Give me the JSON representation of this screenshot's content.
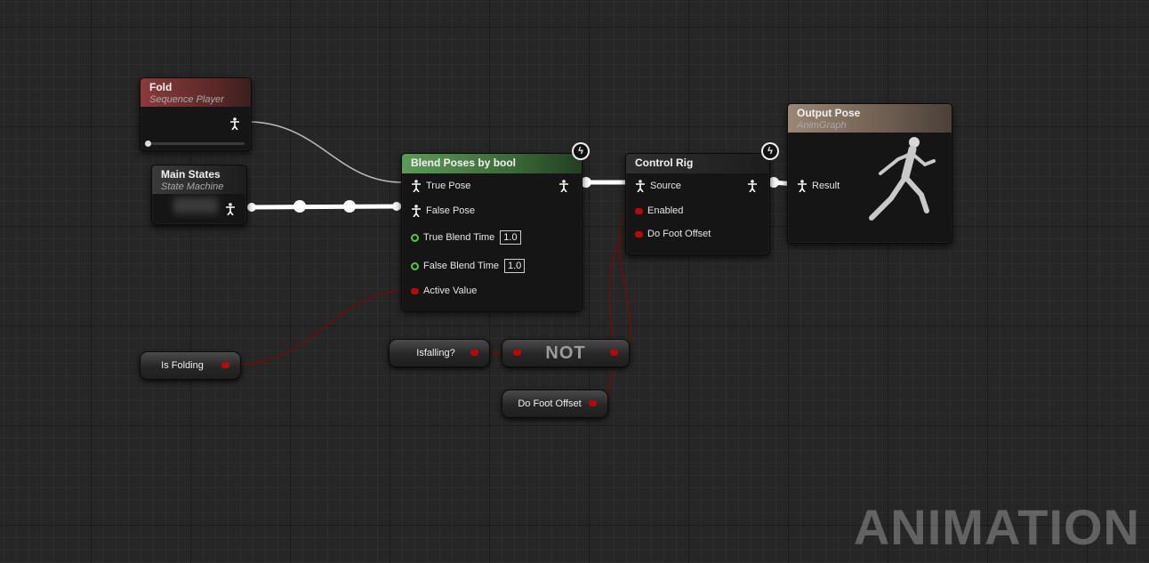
{
  "graph": {
    "watermark": "ANIMATION",
    "colors": {
      "pose_wire": "#ffffff",
      "bool_pin": "#b40a0a",
      "float_pin": "#56c94a",
      "blend_header": "#5a8a55",
      "fold_header": "#7a3535",
      "output_header": "#8f7d6a"
    }
  },
  "nodes": {
    "fold": {
      "title": "Fold",
      "subtitle": "Sequence Player"
    },
    "main_states": {
      "title": "Main States",
      "subtitle": "State Machine"
    },
    "blend": {
      "title": "Blend Poses by bool",
      "pins": {
        "true_pose": "True Pose",
        "false_pose": "False Pose",
        "true_blend_time": "True Blend Time",
        "true_blend_value": "1.0",
        "false_blend_time": "False Blend Time",
        "false_blend_value": "1.0",
        "active_value": "Active Value"
      }
    },
    "control_rig": {
      "title": "Control Rig",
      "pins": {
        "source": "Source",
        "enabled": "Enabled",
        "do_foot_offset": "Do Foot Offset"
      }
    },
    "output_pose": {
      "title": "Output Pose",
      "subtitle": "AnimGraph",
      "pins": {
        "result": "Result"
      }
    },
    "is_folding": {
      "label": "Is Folding"
    },
    "is_falling": {
      "label": "Isfalling?"
    },
    "not": {
      "label": "NOT"
    },
    "do_foot_offset_var": {
      "label": "Do Foot Offset"
    }
  }
}
